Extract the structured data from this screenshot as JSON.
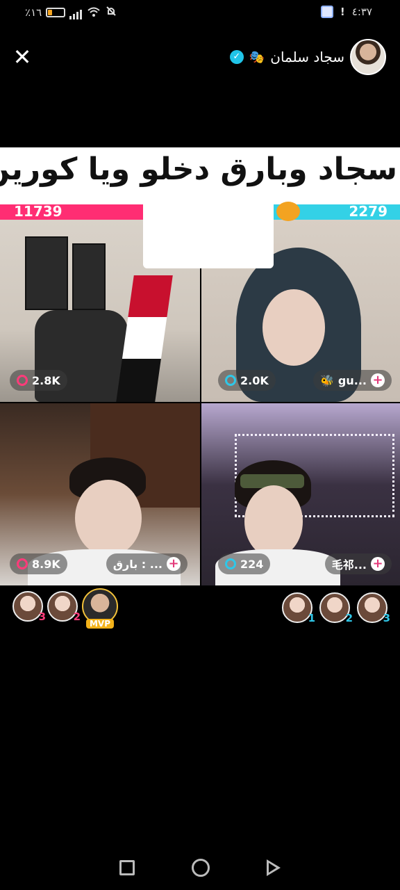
{
  "status_bar": {
    "battery": "٪١٦",
    "time": "٤:٣٧"
  },
  "header": {
    "host_name": "سجاد سلمان",
    "host_emoji": "🎭",
    "verified_icon": "✓",
    "close_label": "✕"
  },
  "caption": {
    "text": "سجاد وبارق دخلو ويا كورين",
    "emojis": "😂😂"
  },
  "battle": {
    "left_score": "11739",
    "right_score": "2279",
    "left_color": "#ff2d73",
    "right_color": "#33d1e6"
  },
  "tiles": [
    {
      "count": "2.8K"
    },
    {
      "count": "2.0K",
      "user": "gu..."
    },
    {
      "count": "8.9K",
      "user": "بارق : ..."
    },
    {
      "count": "224",
      "user": "毛祁..."
    }
  ],
  "gifters_left": [
    {
      "rank": "3"
    },
    {
      "rank": "2"
    },
    {
      "badge": "MVP"
    }
  ],
  "gifters_right": [
    {
      "rank": "1"
    },
    {
      "rank": "2"
    },
    {
      "rank": "3"
    }
  ]
}
